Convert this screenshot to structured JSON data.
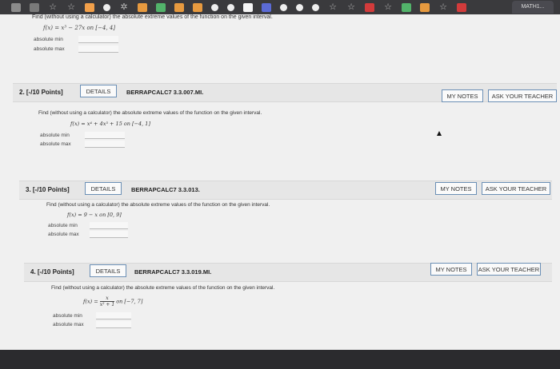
{
  "browser": {
    "active_tab_label": "MATH1...",
    "tab_icons": [
      "page-icon",
      "star-icon",
      "star-icon",
      "camera-icon",
      "page-icon",
      "star-icon",
      "orange-icon",
      "green-icon",
      "orange-icon",
      "orange-icon",
      "chrome-icon",
      "chrome-icon",
      "white-icon",
      "purple-icon",
      "chrome-icon",
      "chrome-icon",
      "chrome-icon",
      "star-icon",
      "star-icon",
      "red-icon",
      "star-icon",
      "green-icon",
      "orange-icon",
      "star-icon",
      "red-icon"
    ]
  },
  "q1": {
    "instruction": "Find (without using a calculator) the absolute extreme values of the function on the given interval.",
    "function_text": "f(x) = x³ − 27x on [−4, 4]",
    "abs_min_label": "absolute min",
    "abs_max_label": "absolute max"
  },
  "questions": [
    {
      "number": "2. [-/10 Points]",
      "details": "DETAILS",
      "ref": "BERRAPCALC7 3.3.007.MI.",
      "my_notes": "MY NOTES",
      "ask_teacher": "ASK YOUR TEACHER",
      "instruction": "Find (without using a calculator) the absolute extreme values of the function on the given interval.",
      "function_text": "f(x) = x⁴ + 4x³ + 15 on [−4, 1]",
      "abs_min_label": "absolute min",
      "abs_max_label": "absolute max"
    },
    {
      "number": "3. [-/10 Points]",
      "details": "DETAILS",
      "ref": "BERRAPCALC7 3.3.013.",
      "my_notes": "MY NOTES",
      "ask_teacher": "ASK YOUR TEACHER",
      "instruction": "Find (without using a calculator) the absolute extreme values of the function on the given interval.",
      "function_text": "f(x) = 9 − x on [0, 9]",
      "abs_min_label": "absolute min",
      "abs_max_label": "absolute max"
    },
    {
      "number": "4. [-/10 Points]",
      "details": "DETAILS",
      "ref": "BERRAPCALC7 3.3.019.MI.",
      "my_notes": "MY NOTES",
      "ask_teacher": "ASK YOUR TEACHER",
      "instruction": "Find (without using a calculator) the absolute extreme values of the function on the given interval.",
      "function_prefix": "f(x) =",
      "fraction_num": "x",
      "fraction_den": "x² + 1",
      "interval": "on [−7, 7]",
      "abs_min_label": "absolute min",
      "abs_max_label": "absolute max"
    }
  ]
}
